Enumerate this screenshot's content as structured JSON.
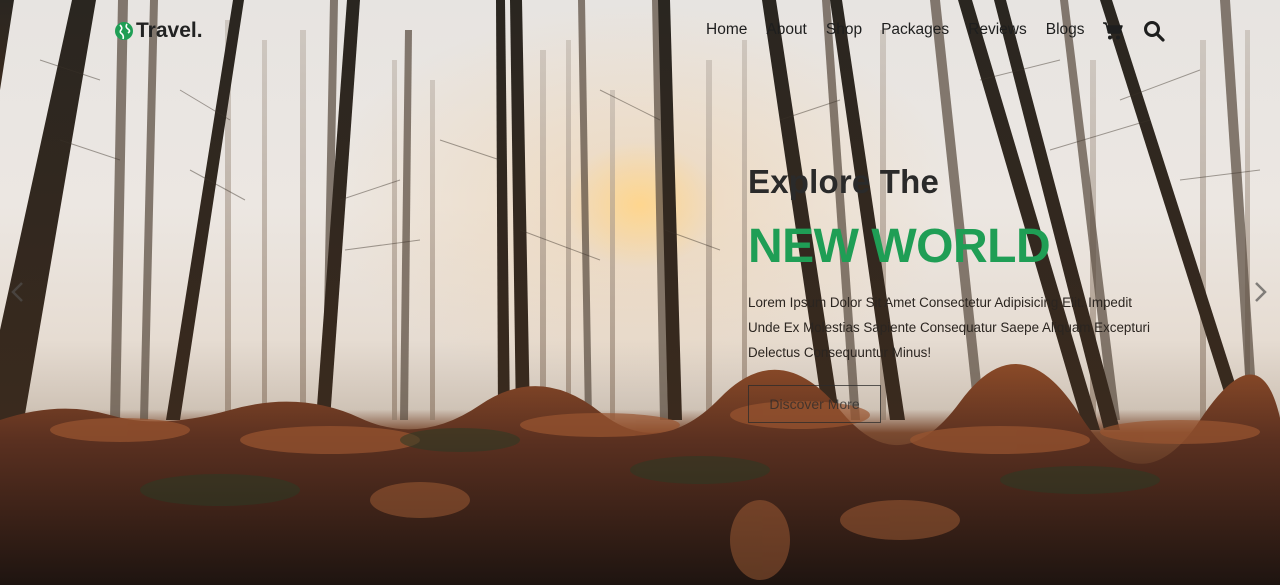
{
  "header": {
    "logo_text": "Travel.",
    "logo_icon": "globe-icon",
    "nav": [
      {
        "label": "Home"
      },
      {
        "label": "About"
      },
      {
        "label": "Shop"
      },
      {
        "label": "Packages"
      },
      {
        "label": "Reviews"
      },
      {
        "label": "Blogs"
      }
    ],
    "cart_icon": "cart-icon",
    "search_icon": "search-icon"
  },
  "hero": {
    "pre_title": "Explore The",
    "title": "NEW WORLD",
    "description": "Lorem Ipsum Dolor Sit Amet Consectetur Adipisicing Elit. Impedit Unde Ex Molestias Sapiente Consequatur Saepe Aliquam Excepturi Delectus Consequuntur Minus!",
    "cta_label": "Discover More"
  },
  "slider": {
    "prev_icon": "chevron-left-icon",
    "next_icon": "chevron-right-icon"
  },
  "colors": {
    "accent": "#1f9e55",
    "text_dark": "#1e1e1e"
  }
}
